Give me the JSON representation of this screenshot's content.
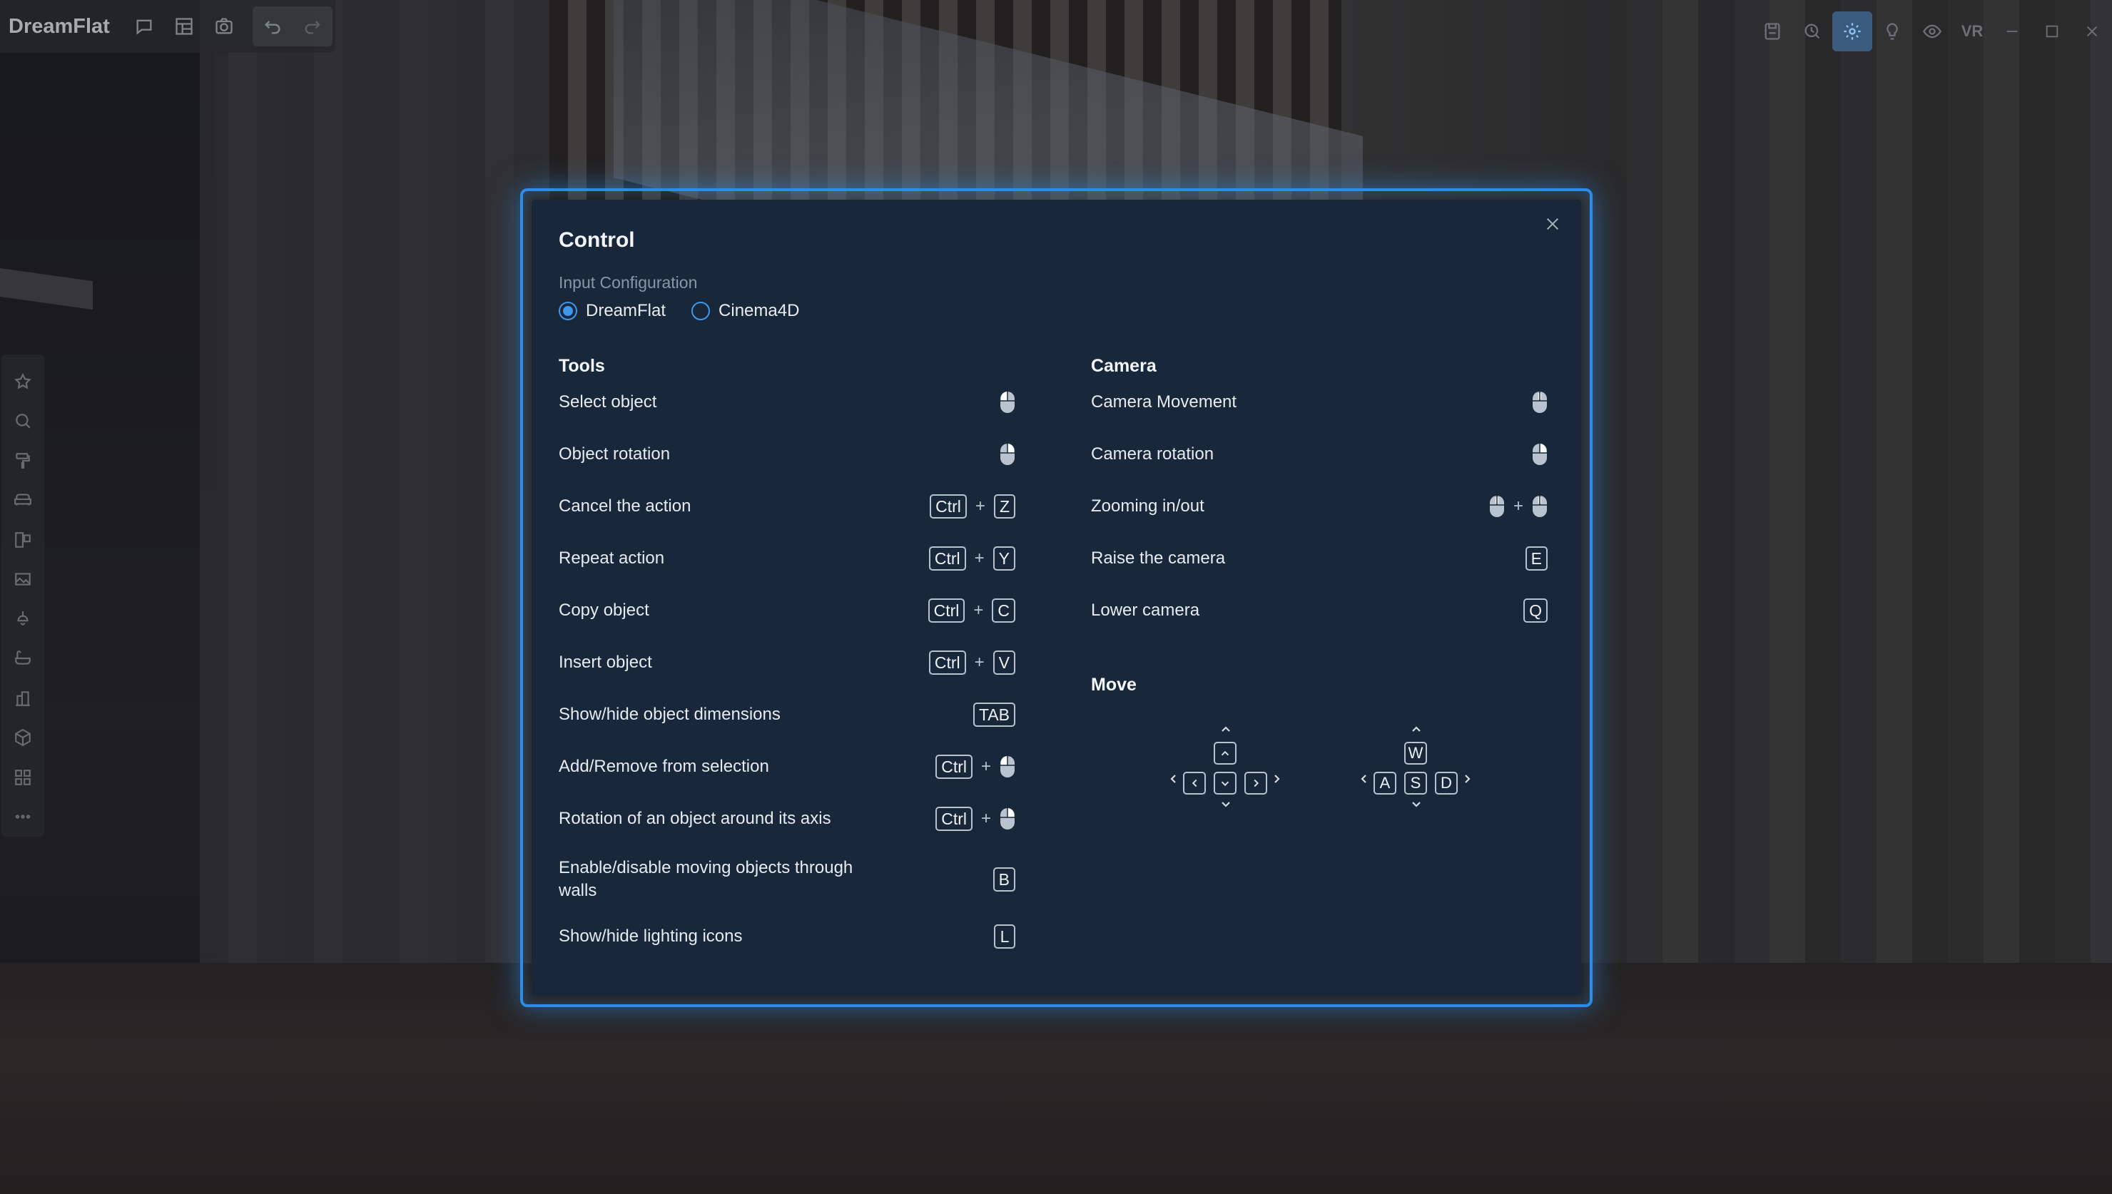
{
  "app": {
    "name": "DreamFlat",
    "vr_label": "VR"
  },
  "toolbar_left_icons": [
    "comment-icon",
    "layout-icon",
    "camera-icon",
    "undo-icon",
    "redo-icon"
  ],
  "toolbar_right_icons": [
    "save-icon",
    "render-settings-icon",
    "settings-icon",
    "light-bulb-icon",
    "eye-icon"
  ],
  "sidebar_icons": [
    "star-icon",
    "search-icon",
    "paint-roller-icon",
    "sofa-icon",
    "door-window-icon",
    "gallery-icon",
    "ceiling-lamp-icon",
    "bathtub-icon",
    "building-icon",
    "cube-icon",
    "apps-grid-icon",
    "more-icon"
  ],
  "dialog": {
    "title": "Control",
    "input_config_label": "Input Configuration",
    "options": [
      {
        "label": "DreamFlat",
        "selected": true
      },
      {
        "label": "Cinema4D",
        "selected": false
      }
    ],
    "accent_color": "#3d97eb"
  },
  "tools": {
    "heading": "Tools",
    "rows": [
      {
        "label": "Select object",
        "keys": [
          "mouse-left"
        ]
      },
      {
        "label": "Object rotation",
        "keys": [
          "mouse-right"
        ]
      },
      {
        "label": "Cancel the action",
        "keys": [
          "Ctrl",
          "+",
          "Z"
        ]
      },
      {
        "label": "Repeat action",
        "keys": [
          "Ctrl",
          "+",
          "Y"
        ]
      },
      {
        "label": "Copy object",
        "keys": [
          "Ctrl",
          "+",
          "C"
        ]
      },
      {
        "label": "Insert object",
        "keys": [
          "Ctrl",
          "+",
          "V"
        ]
      },
      {
        "label": "Show/hide object dimensions",
        "keys": [
          "TAB"
        ]
      },
      {
        "label": "Add/Remove from selection",
        "keys": [
          "Ctrl",
          "+",
          "mouse-left"
        ]
      },
      {
        "label": "Rotation of an object around its axis",
        "keys": [
          "Ctrl",
          "+",
          "mouse-right"
        ]
      },
      {
        "label": "Enable/disable moving objects through walls",
        "keys": [
          "B"
        ]
      },
      {
        "label": "Show/hide lighting icons",
        "keys": [
          "L"
        ]
      }
    ]
  },
  "camera": {
    "heading": "Camera",
    "rows": [
      {
        "label": "Camera Movement",
        "keys": [
          "mouse-middle"
        ]
      },
      {
        "label": "Camera rotation",
        "keys": [
          "mouse-right"
        ]
      },
      {
        "label": "Zooming in/out",
        "keys": [
          "mouse-scroll",
          "+",
          "mouse-scroll"
        ]
      },
      {
        "label": "Raise the camera",
        "keys": [
          "E"
        ]
      },
      {
        "label": "Lower camera",
        "keys": [
          "Q"
        ]
      }
    ]
  },
  "move": {
    "heading": "Move",
    "wasd": {
      "up": "W",
      "left": "A",
      "down": "S",
      "right": "D"
    }
  }
}
